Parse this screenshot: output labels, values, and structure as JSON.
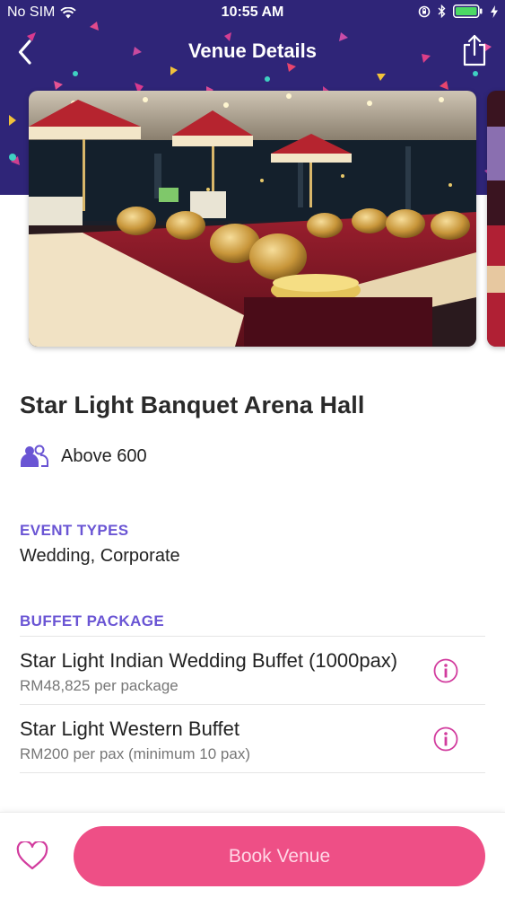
{
  "status_bar": {
    "carrier": "No SIM",
    "time": "10:55 AM"
  },
  "nav": {
    "title": "Venue Details",
    "back_icon": "chevron-left-icon",
    "share_icon": "share-icon"
  },
  "venue": {
    "name": "Star Light Banquet Arena Hall",
    "capacity": "Above 600",
    "capacity_icon": "people-icon"
  },
  "event_types": {
    "label": "EVENT TYPES",
    "value": "Wedding, Corporate"
  },
  "buffet": {
    "label": "BUFFET PACKAGE",
    "packages": [
      {
        "name": "Star Light Indian Wedding Buffet (1000pax)",
        "price": "RM48,825 per package"
      },
      {
        "name": "Star Light Western Buffet",
        "price": "RM200 per pax (minimum 10 pax)"
      }
    ]
  },
  "footer": {
    "book_label": "Book Venue",
    "favorite_icon": "heart-icon"
  },
  "colors": {
    "header_bg": "#2f2578",
    "accent_purple": "#6a55d4",
    "accent_pink": "#ee4f86",
    "info_icon": "#d23c9e"
  }
}
